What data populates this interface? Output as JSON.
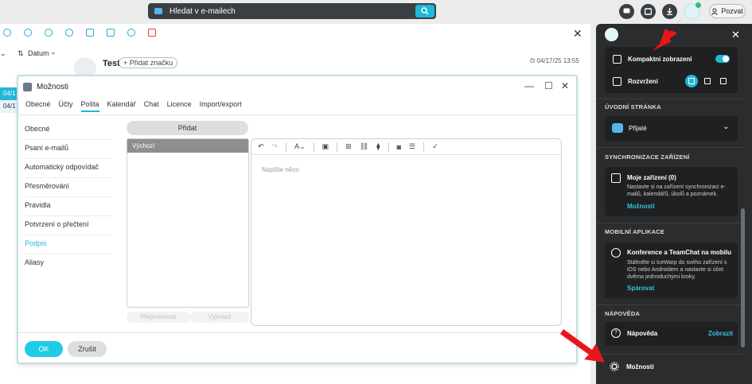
{
  "topbar": {
    "search_placeholder": "Hledat v e-mailech",
    "invite_label": "Pozvat"
  },
  "mail": {
    "sort_label": "Datum",
    "list_dates": [
      "04/1",
      "04/1"
    ],
    "subject": "Test",
    "add_tag_label": "+ Přidat značku",
    "date": "čt 04/17/25 13:55"
  },
  "dialog": {
    "title": "Možnosti",
    "tabs": [
      "Obecné",
      "Účty",
      "Pošta",
      "Kalendář",
      "Chat",
      "Licence",
      "Import/export"
    ],
    "active_tab": "Pošta",
    "side_items": [
      "Obecné",
      "Psaní e-mailů",
      "Automatický odpovídač",
      "Přesměrování",
      "Pravidla",
      "Potvrzení o přečtení",
      "Podpis",
      "Aliasy"
    ],
    "active_side_item": "Podpis",
    "add_label": "Přidat",
    "signature_items": [
      "Výchozí"
    ],
    "rename_label": "Přejmenovat",
    "cut_label": "Vyjmout",
    "editor_placeholder": "Napište něco",
    "ok_label": "OK",
    "cancel_label": "Zrušit"
  },
  "panel": {
    "compact_label": "Kompaktní zobrazení",
    "compact_on": true,
    "layout_label": "Rozvržení",
    "home_header": "ÚVODNÍ STRÁNKA",
    "home_value": "Přijaté",
    "sync_header": "SYNCHRONIZACE ZAŘÍZENÍ",
    "sync_title": "Moje zařízení (0)",
    "sync_text": "Nastavte si na zařízení synchronizaci e-mailů, kalendářů, úkolů a poznámek.",
    "sync_link": "Možnosti",
    "mobile_header": "MOBILNÍ APLIKACE",
    "mobile_title": "Konference a TeamChat na mobilu",
    "mobile_text": "Stáhněte si IceWarp do svého zařízení s iOS nebo Androidem a nastavte si účet dvěma jednoduchými kroky.",
    "mobile_link": "Spárovat",
    "help_header": "NÁPOVĚDA",
    "help_label": "Nápověda",
    "help_link": "Zobrazit",
    "settings_label": "Možnosti"
  },
  "colors": {
    "accent": "#1fb8d8",
    "panel_bg": "#2a2c2e",
    "arrow": "#e8161b"
  }
}
